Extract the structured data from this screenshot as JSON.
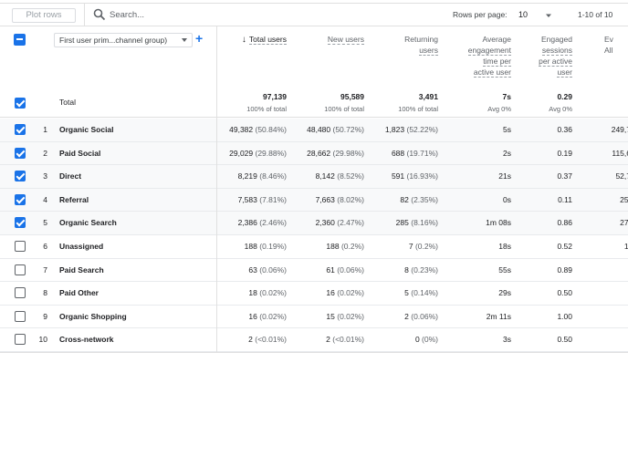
{
  "toolbar": {
    "plot_rows_label": "Plot rows",
    "search_placeholder": "Search...",
    "rows_per_page_label": "Rows per page:",
    "rows_per_page_value": "10",
    "range_label": "1-10 of 10"
  },
  "dimension": {
    "select_label": "First user prim...channel group)",
    "add_icon": "plus-icon"
  },
  "columns": [
    {
      "line1": "Total users",
      "sorted": true
    },
    {
      "line1": "New users"
    },
    {
      "line1": "Returning",
      "line2": "users"
    },
    {
      "line1": "Average",
      "line2": "engagement",
      "line3": "time per",
      "line4": "active user"
    },
    {
      "line1": "Engaged",
      "line2": "sessions",
      "line3": "per active",
      "line4": "user"
    },
    {
      "line1": "Ev",
      "line2": "All"
    }
  ],
  "totals": {
    "label": "Total",
    "values": [
      "97,139",
      "95,589",
      "3,491",
      "7s",
      "0.29"
    ],
    "subs": [
      "100% of total",
      "100% of total",
      "100% of total",
      "Avg 0%",
      "Avg 0%"
    ]
  },
  "rows": [
    {
      "idx": "1",
      "name": "Organic Social",
      "checked": true,
      "total": "49,382",
      "total_pct": "(50.84%)",
      "new": "48,480",
      "new_pct": "(50.72%)",
      "ret": "1,823",
      "ret_pct": "(52.22%)",
      "avg": "5s",
      "eng": "0.36",
      "ev": "249,7"
    },
    {
      "idx": "2",
      "name": "Paid Social",
      "checked": true,
      "total": "29,029",
      "total_pct": "(29.88%)",
      "new": "28,662",
      "new_pct": "(29.98%)",
      "ret": "688",
      "ret_pct": "(19.71%)",
      "avg": "2s",
      "eng": "0.19",
      "ev": "115,6"
    },
    {
      "idx": "3",
      "name": "Direct",
      "checked": true,
      "total": "8,219",
      "total_pct": "(8.46%)",
      "new": "8,142",
      "new_pct": "(8.52%)",
      "ret": "591",
      "ret_pct": "(16.93%)",
      "avg": "21s",
      "eng": "0.37",
      "ev": "52,7"
    },
    {
      "idx": "4",
      "name": "Referral",
      "checked": true,
      "total": "7,583",
      "total_pct": "(7.81%)",
      "new": "7,663",
      "new_pct": "(8.02%)",
      "ret": "82",
      "ret_pct": "(2.35%)",
      "avg": "0s",
      "eng": "0.11",
      "ev": "25,"
    },
    {
      "idx": "5",
      "name": "Organic Search",
      "checked": true,
      "total": "2,386",
      "total_pct": "(2.46%)",
      "new": "2,360",
      "new_pct": "(2.47%)",
      "ret": "285",
      "ret_pct": "(8.16%)",
      "avg": "1m 08s",
      "eng": "0.86",
      "ev": "27,"
    },
    {
      "idx": "6",
      "name": "Unassigned",
      "checked": false,
      "total": "188",
      "total_pct": "(0.19%)",
      "new": "188",
      "new_pct": "(0.2%)",
      "ret": "7",
      "ret_pct": "(0.2%)",
      "avg": "18s",
      "eng": "0.52",
      "ev": "1,"
    },
    {
      "idx": "7",
      "name": "Paid Search",
      "checked": false,
      "total": "63",
      "total_pct": "(0.06%)",
      "new": "61",
      "new_pct": "(0.06%)",
      "ret": "8",
      "ret_pct": "(0.23%)",
      "avg": "55s",
      "eng": "0.89",
      "ev": ""
    },
    {
      "idx": "8",
      "name": "Paid Other",
      "checked": false,
      "total": "18",
      "total_pct": "(0.02%)",
      "new": "16",
      "new_pct": "(0.02%)",
      "ret": "5",
      "ret_pct": "(0.14%)",
      "avg": "29s",
      "eng": "0.50",
      "ev": ""
    },
    {
      "idx": "9",
      "name": "Organic Shopping",
      "checked": false,
      "total": "16",
      "total_pct": "(0.02%)",
      "new": "15",
      "new_pct": "(0.02%)",
      "ret": "2",
      "ret_pct": "(0.06%)",
      "avg": "2m 11s",
      "eng": "1.00",
      "ev": ""
    },
    {
      "idx": "10",
      "name": "Cross-network",
      "checked": false,
      "total": "2",
      "total_pct": "(<0.01%)",
      "new": "2",
      "new_pct": "(<0.01%)",
      "ret": "0",
      "ret_pct": "(0%)",
      "avg": "3s",
      "eng": "0.50",
      "ev": ""
    }
  ],
  "colors": {
    "accent": "#1a73e8",
    "shaded_row": "#f8f9fa"
  }
}
